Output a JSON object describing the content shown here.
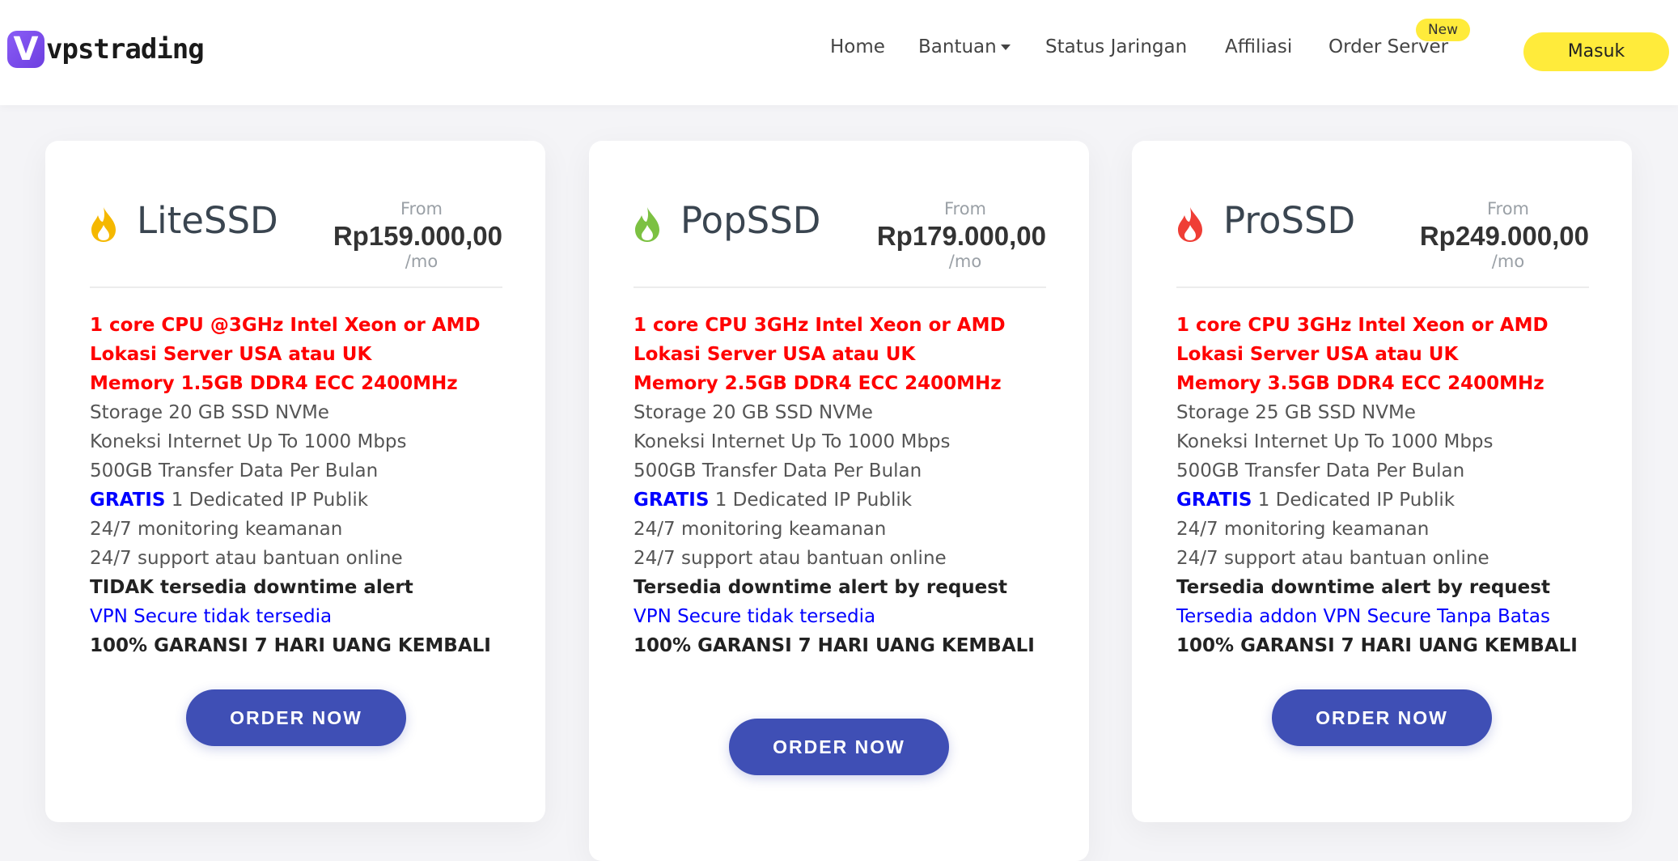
{
  "brand": {
    "logo_letter": "V",
    "name": "vpstrading"
  },
  "nav": {
    "items": [
      "Home",
      "Bantuan",
      "Status Jaringan",
      "Affiliasi",
      "Order Server"
    ],
    "new_badge": "New",
    "login": "Masuk"
  },
  "colors": {
    "accent_yellow": "#ffeb3b",
    "button_blue": "#3f4fb5",
    "feature_red": "#ff0000",
    "feature_blue": "#0000ff",
    "lite_icon": "#f5b800",
    "pop_icon": "#7cc142",
    "pro_icon": "#ef3e36"
  },
  "plans": [
    {
      "name": "LiteSSD",
      "icon": "flame-icon",
      "from": "From",
      "price": "Rp159.000,00",
      "per": "/mo",
      "features": {
        "cpu": "1 core CPU @3GHz Intel Xeon or AMD",
        "location": "Lokasi Server USA atau UK",
        "memory": "Memory 1.5GB DDR4 ECC 2400MHz",
        "storage": "Storage 20 GB SSD NVMe",
        "network": "Koneksi Internet Up To 1000 Mbps",
        "transfer": "500GB Transfer Data Per Bulan",
        "ip_gratis": "GRATIS",
        "ip_rest": " 1 Dedicated IP Publik",
        "monitoring": "24/7 monitoring keamanan",
        "support": "24/7 support atau bantuan online",
        "alert": "TIDAK tersedia downtime alert",
        "vpn": "VPN Secure tidak tersedia",
        "guarantee": "100% GARANSI 7 HARI UANG KEMBALI"
      },
      "order": "ORDER NOW"
    },
    {
      "name": "PopSSD",
      "icon": "flame-icon",
      "from": "From",
      "price": "Rp179.000,00",
      "per": "/mo",
      "features": {
        "cpu": "1 core CPU 3GHz Intel Xeon or AMD",
        "location": "Lokasi Server USA atau UK",
        "memory": "Memory 2.5GB DDR4 ECC 2400MHz",
        "storage": "Storage 20 GB SSD NVMe",
        "network": "Koneksi Internet Up To 1000 Mbps",
        "transfer": "500GB Transfer Data Per Bulan",
        "ip_gratis": "GRATIS",
        "ip_rest": " 1 Dedicated IP Publik",
        "monitoring": "24/7 monitoring keamanan",
        "support": "24/7 support atau bantuan online",
        "alert": "Tersedia downtime alert by request",
        "vpn": "VPN Secure tidak tersedia",
        "guarantee": "100% GARANSI 7 HARI UANG KEMBALI"
      },
      "order": "ORDER NOW"
    },
    {
      "name": "ProSSD",
      "icon": "flame-icon",
      "from": "From",
      "price": "Rp249.000,00",
      "per": "/mo",
      "features": {
        "cpu": "1 core CPU 3GHz Intel Xeon or AMD",
        "location": "Lokasi Server USA atau UK",
        "memory": "Memory 3.5GB DDR4 ECC 2400MHz",
        "storage": "Storage 25 GB SSD NVMe",
        "network": "Koneksi Internet Up To 1000 Mbps",
        "transfer": "500GB Transfer Data Per Bulan",
        "ip_gratis": "GRATIS",
        "ip_rest": " 1 Dedicated IP Publik",
        "monitoring": "24/7 monitoring keamanan",
        "support": "24/7 support atau bantuan online",
        "alert": "Tersedia downtime alert by request",
        "vpn": "Tersedia addon VPN Secure Tanpa Batas",
        "guarantee": "100% GARANSI 7 HARI UANG KEMBALI"
      },
      "order": "ORDER NOW"
    }
  ]
}
